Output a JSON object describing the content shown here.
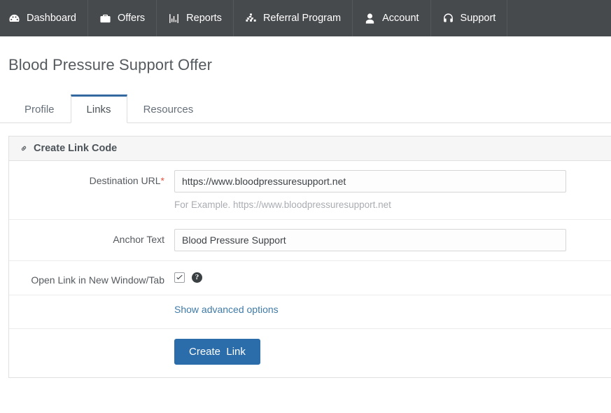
{
  "navbar": {
    "items": [
      {
        "label": "Dashboard",
        "icon": "dashboard-icon"
      },
      {
        "label": "Offers",
        "icon": "briefcase-icon"
      },
      {
        "label": "Reports",
        "icon": "bar-chart-icon"
      },
      {
        "label": "Referral Program",
        "icon": "sitemap-icon"
      },
      {
        "label": "Account",
        "icon": "user-icon"
      },
      {
        "label": "Support",
        "icon": "headset-icon"
      }
    ]
  },
  "page": {
    "title": "Blood Pressure Support Offer"
  },
  "tabs": [
    {
      "label": "Profile",
      "active": false
    },
    {
      "label": "Links",
      "active": true
    },
    {
      "label": "Resources",
      "active": false
    }
  ],
  "panel": {
    "heading": "Create Link Code",
    "heading_icon": "link-icon",
    "fields": {
      "destination_url": {
        "label": "Destination URL",
        "required_marker": "*",
        "value": "https://www.bloodpressuresupport.net",
        "placeholder": "",
        "help": "For Example. https://www.bloodpressuresupport.net"
      },
      "anchor_text": {
        "label": "Anchor Text",
        "value": "Blood Pressure Support",
        "placeholder": ""
      },
      "open_new_window": {
        "label": "Open Link in New Window/Tab",
        "checked": true,
        "help_icon": "question-circle-icon"
      }
    },
    "advanced_link": "Show advanced options",
    "submit_button": "Create  Link"
  },
  "colors": {
    "navbar_bg": "#474a4d",
    "accent_blue": "#2b6cab",
    "tab_active_border": "#33699f",
    "required_red": "#e8543f",
    "link_blue": "#3f7ba8"
  }
}
